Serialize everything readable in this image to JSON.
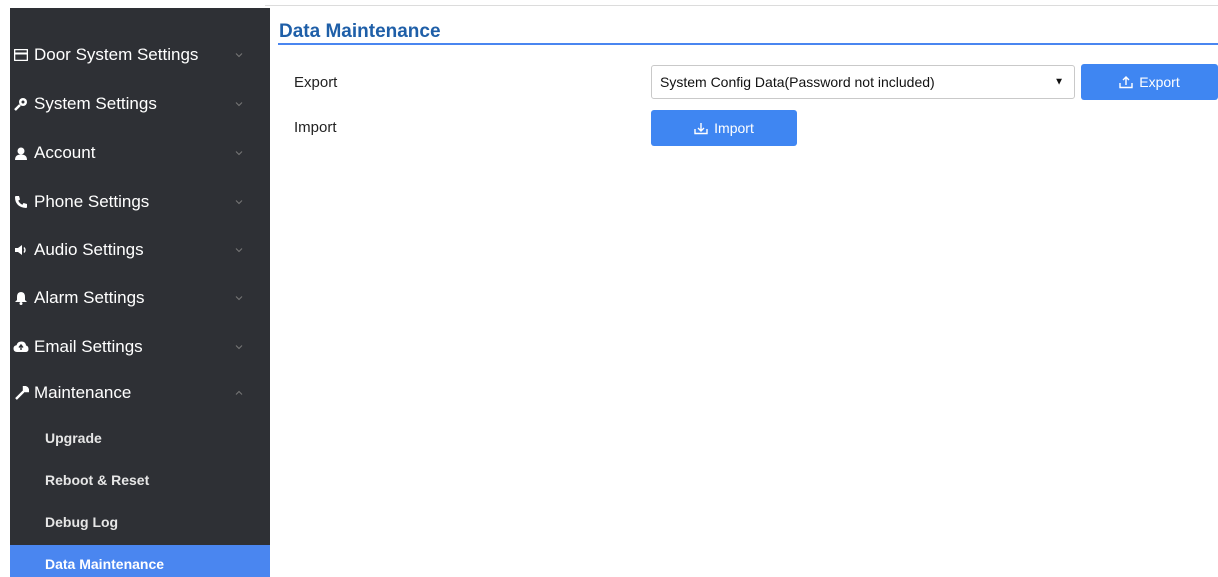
{
  "sidebar": {
    "items": [
      {
        "label": "Door System Settings",
        "icon": "card-icon"
      },
      {
        "label": "System Settings",
        "icon": "key-icon"
      },
      {
        "label": "Account",
        "icon": "user-icon"
      },
      {
        "label": "Phone Settings",
        "icon": "phone-icon"
      },
      {
        "label": "Audio Settings",
        "icon": "speaker-icon"
      },
      {
        "label": "Alarm Settings",
        "icon": "bell-icon"
      },
      {
        "label": "Email Settings",
        "icon": "cloud-icon"
      },
      {
        "label": "Maintenance",
        "icon": "wrench-icon",
        "expanded": true
      }
    ],
    "subitems": [
      {
        "label": "Upgrade"
      },
      {
        "label": "Reboot & Reset"
      },
      {
        "label": "Debug Log"
      },
      {
        "label": "Data Maintenance",
        "active": true
      }
    ]
  },
  "main": {
    "title": "Data Maintenance",
    "export_label": "Export",
    "export_select_value": "System Config Data(Password not included)",
    "export_button": "Export",
    "import_label": "Import",
    "import_button": "Import"
  },
  "colors": {
    "sidebar_bg": "#2e3035",
    "accent": "#4a86f0",
    "title": "#1f5fa8"
  }
}
